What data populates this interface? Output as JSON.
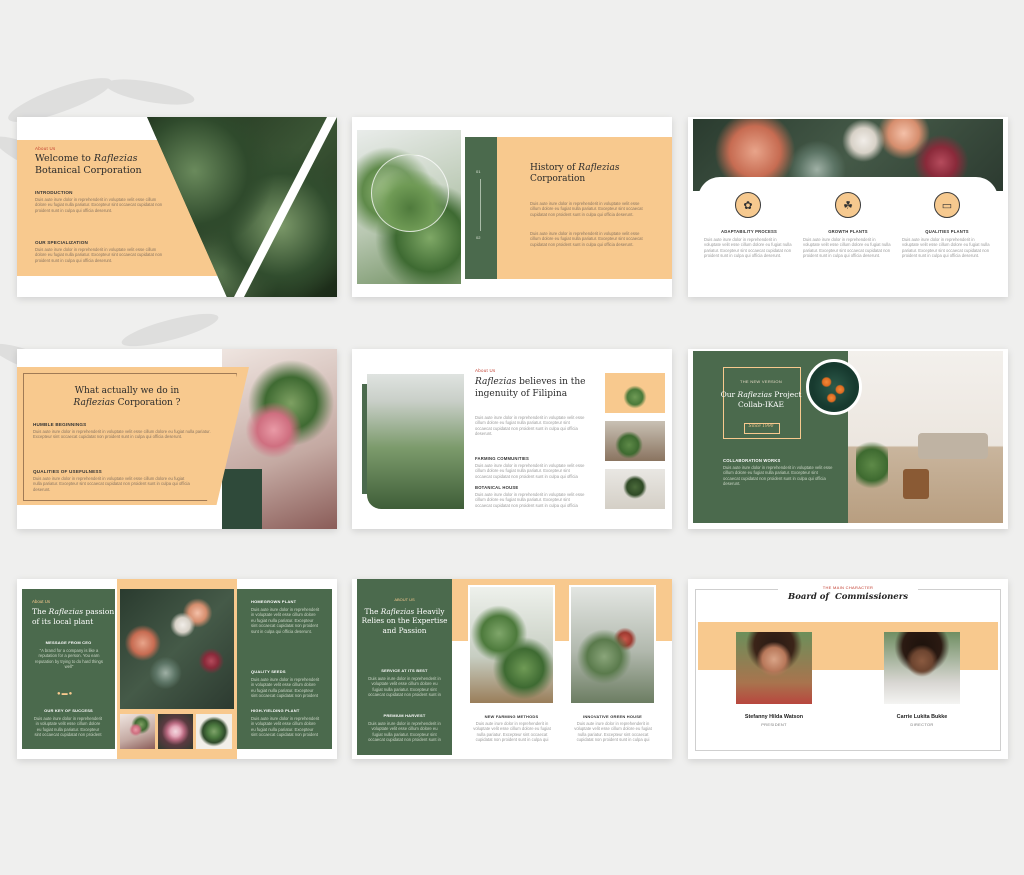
{
  "lorem": "Duis aute irure dolor in reprehenderit in voluptate velit esse cillum dolore eu fugiat nulla pariatur. Excepteur sint occaecat cupidatat non proident sunt in culpa qui officia deserunt.",
  "s1": {
    "kicker": "About Us",
    "title_a": "Welcome to ",
    "title_b": "Raflezias",
    "title_c": "Botanical Corporation",
    "h1": "INTRODUCTION",
    "h2": "OUR SPECIALIZATION"
  },
  "s2": {
    "title_a": "History of ",
    "title_b": "Raflezias",
    "title_c": "Corporation",
    "num1": "01",
    "num2": "02"
  },
  "s3": {
    "items": [
      {
        "label": "ADAPTABILITY PROCESS",
        "icon": "brain-icon"
      },
      {
        "label": "GROWTH PLANTS",
        "icon": "plant-growth-icon"
      },
      {
        "label": "QUALITIES PLANTS",
        "icon": "laptop-icon"
      }
    ]
  },
  "s4": {
    "title_a": "What actually we do in",
    "title_b": "Raflezias",
    "title_c": " Corporation ?",
    "h1": "HUMBLE BEGINNINGS",
    "h2": "QUALITIES OF USEFULNESS"
  },
  "s5": {
    "kicker": "About Us",
    "title_a": "Raflezias",
    "title_b": " believes in the",
    "title_c": "ingenuity of Filipina",
    "h1": "FARMING COMMUNITIES",
    "h2": "BOTANICAL HOUSE"
  },
  "s6": {
    "kicker": "THE NEW VERSION",
    "title_a": "Our ",
    "title_b": "Raflezias",
    "title_c": " Project",
    "title_d": "Collab-IKAE",
    "since": "Since 1990",
    "h1": "COLLABORATION WORKS"
  },
  "s7": {
    "kicker": "About Us",
    "title_a": "The ",
    "title_b": "Raflezias",
    "title_c": " passion",
    "title_d": "of its local plant",
    "msg_head": "MESSAGE FROM CEO",
    "quote": "\"A brand for a company is like a reputation for a person. You earn reputation by trying to do hard things well\"",
    "key_head": "OUR KEY OF SUCCESS",
    "r1": "HOMEGROWN PLANT",
    "r2": "QUALITY SEEDS",
    "r3": "HIGH-YIELDING PLANT"
  },
  "s8": {
    "kicker": "ABOUT US",
    "title_a": "The ",
    "title_b": "Raflezias",
    "title_c": " Heavily",
    "title_d": "Relies on the Expertise",
    "title_e": "and Passion",
    "h1": "SERVICE AT ITS BEST",
    "h2": "PREMIUM HARVEST",
    "c1": "NEW FARMING METHODS",
    "c2": "INNOVATIVE GREEN HOUSE"
  },
  "s9": {
    "kicker": "THE MAIN CHARACTER",
    "title": "Board of  Commissioners",
    "p1_name": "Stefanny Hilda Watson",
    "p1_role": "PRESIDENT",
    "p2_name": "Carrie Lukita Bukke",
    "p2_role": "DIRECTOR"
  }
}
